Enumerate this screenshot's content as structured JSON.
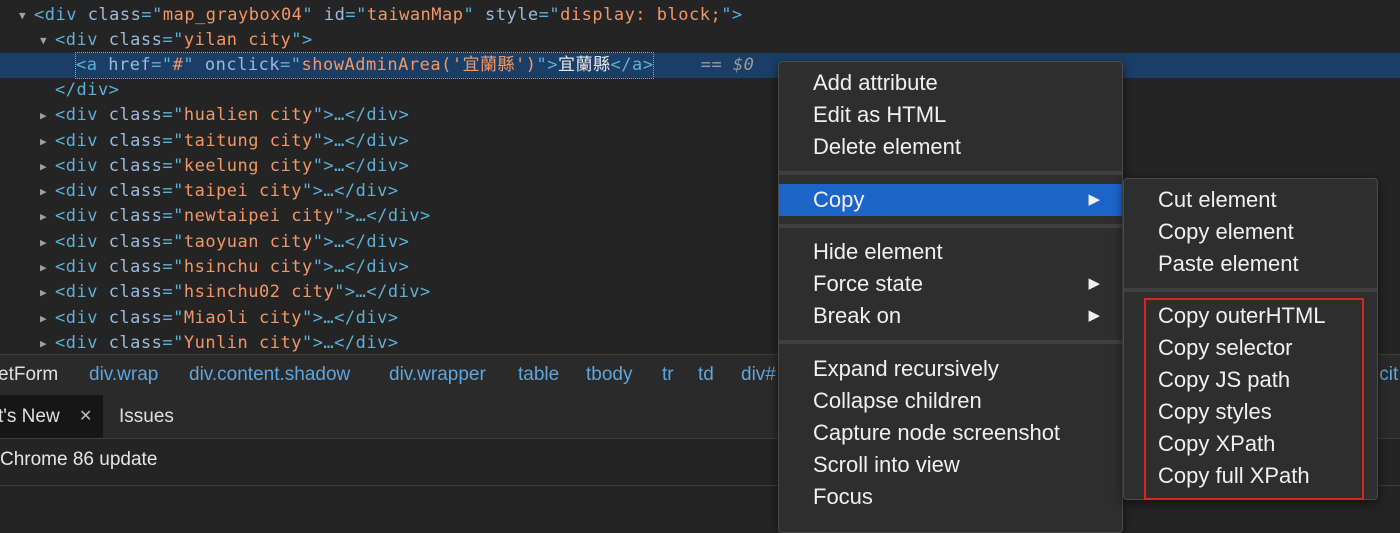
{
  "dom_tree": {
    "lines": [
      {
        "indent_tri": "▼",
        "parts": [
          [
            "tag",
            "<div "
          ],
          [
            "attr",
            "class"
          ],
          [
            "tag",
            "=\""
          ],
          [
            "val",
            "map_graybox04"
          ],
          [
            "tag",
            "\" "
          ],
          [
            "attr",
            "id"
          ],
          [
            "tag",
            "=\""
          ],
          [
            "val",
            "taiwanMap"
          ],
          [
            "tag",
            "\" "
          ],
          [
            "attr",
            "style"
          ],
          [
            "tag",
            "=\""
          ],
          [
            "val",
            "display: block;"
          ],
          [
            "tag",
            "\">"
          ]
        ]
      },
      {
        "indent_tri": "▼",
        "parts": [
          [
            "tag",
            "<div "
          ],
          [
            "attr",
            "class"
          ],
          [
            "tag",
            "=\""
          ],
          [
            "val",
            "yilan city"
          ],
          [
            "tag",
            "\">"
          ]
        ]
      },
      {
        "indent_tri": "",
        "selected": true,
        "parts": [
          [
            "tag",
            "<a "
          ],
          [
            "attr",
            "href"
          ],
          [
            "tag",
            "=\""
          ],
          [
            "val",
            "#"
          ],
          [
            "tag",
            "\" "
          ],
          [
            "attr",
            "onclick"
          ],
          [
            "tag",
            "=\""
          ],
          [
            "val",
            "showAdminArea('宜蘭縣')"
          ],
          [
            "tag",
            "\">"
          ],
          [
            "txt",
            "宜蘭縣"
          ],
          [
            "tag",
            "</a>"
          ]
        ],
        "suffix": " == $0"
      },
      {
        "indent_tri": "",
        "parts": [
          [
            "tag",
            "</div>"
          ]
        ]
      },
      {
        "indent_tri": "▶",
        "parts": [
          [
            "tag",
            "<div "
          ],
          [
            "attr",
            "class"
          ],
          [
            "tag",
            "=\""
          ],
          [
            "val",
            "hualien city"
          ],
          [
            "tag",
            "\">…</div>"
          ]
        ]
      },
      {
        "indent_tri": "▶",
        "parts": [
          [
            "tag",
            "<div "
          ],
          [
            "attr",
            "class"
          ],
          [
            "tag",
            "=\""
          ],
          [
            "val",
            "taitung city"
          ],
          [
            "tag",
            "\">…</div>"
          ]
        ]
      },
      {
        "indent_tri": "▶",
        "parts": [
          [
            "tag",
            "<div "
          ],
          [
            "attr",
            "class"
          ],
          [
            "tag",
            "=\""
          ],
          [
            "val",
            "keelung city"
          ],
          [
            "tag",
            "\">…</div>"
          ]
        ]
      },
      {
        "indent_tri": "▶",
        "parts": [
          [
            "tag",
            "<div "
          ],
          [
            "attr",
            "class"
          ],
          [
            "tag",
            "=\""
          ],
          [
            "val",
            "taipei city"
          ],
          [
            "tag",
            "\">…</div>"
          ]
        ]
      },
      {
        "indent_tri": "▶",
        "parts": [
          [
            "tag",
            "<div "
          ],
          [
            "attr",
            "class"
          ],
          [
            "tag",
            "=\""
          ],
          [
            "val",
            "newtaipei city"
          ],
          [
            "tag",
            "\">…</div>"
          ]
        ]
      },
      {
        "indent_tri": "▶",
        "parts": [
          [
            "tag",
            "<div "
          ],
          [
            "attr",
            "class"
          ],
          [
            "tag",
            "=\""
          ],
          [
            "val",
            "taoyuan city"
          ],
          [
            "tag",
            "\">…</div>"
          ]
        ]
      },
      {
        "indent_tri": "▶",
        "parts": [
          [
            "tag",
            "<div "
          ],
          [
            "attr",
            "class"
          ],
          [
            "tag",
            "=\""
          ],
          [
            "val",
            "hsinchu city"
          ],
          [
            "tag",
            "\">…</div>"
          ]
        ]
      },
      {
        "indent_tri": "▶",
        "parts": [
          [
            "tag",
            "<div "
          ],
          [
            "attr",
            "class"
          ],
          [
            "tag",
            "=\""
          ],
          [
            "val",
            "hsinchu02 city"
          ],
          [
            "tag",
            "\">…</div>"
          ]
        ]
      },
      {
        "indent_tri": "▶",
        "parts": [
          [
            "tag",
            "<div "
          ],
          [
            "attr",
            "class"
          ],
          [
            "tag",
            "=\""
          ],
          [
            "val",
            "Miaoli city"
          ],
          [
            "tag",
            "\">…</div>"
          ]
        ]
      },
      {
        "indent_tri": "▶",
        "parts": [
          [
            "tag",
            "<div "
          ],
          [
            "attr",
            "class"
          ],
          [
            "tag",
            "=\""
          ],
          [
            "val",
            "Yunlin city"
          ],
          [
            "tag",
            "\">…</div>"
          ]
        ]
      }
    ]
  },
  "breadcrumb": {
    "items": [
      "etForm",
      "div.wrap",
      "div.content.shadow",
      "div.wrapper",
      "table",
      "tbody",
      "tr",
      "td",
      "div#",
      ".cit"
    ]
  },
  "drawer": {
    "tabs": [
      "t's New",
      "Issues"
    ],
    "close_glyph": "✕",
    "content": "Chrome 86 update"
  },
  "context_menu": {
    "items": [
      "Add attribute",
      "Edit as HTML",
      "Delete element",
      "Copy",
      "Hide element",
      "Force state",
      "Break on",
      "Expand recursively",
      "Collapse children",
      "Capture node screenshot",
      "Scroll into view",
      "Focus"
    ],
    "arrow": "▶"
  },
  "copy_submenu": {
    "items": [
      "Cut element",
      "Copy element",
      "Paste element",
      "Copy outerHTML",
      "Copy selector",
      "Copy JS path",
      "Copy styles",
      "Copy XPath",
      "Copy full XPath"
    ]
  },
  "colors": {
    "highlight": "#1d64c9",
    "annotation_box": "#d4291f"
  }
}
